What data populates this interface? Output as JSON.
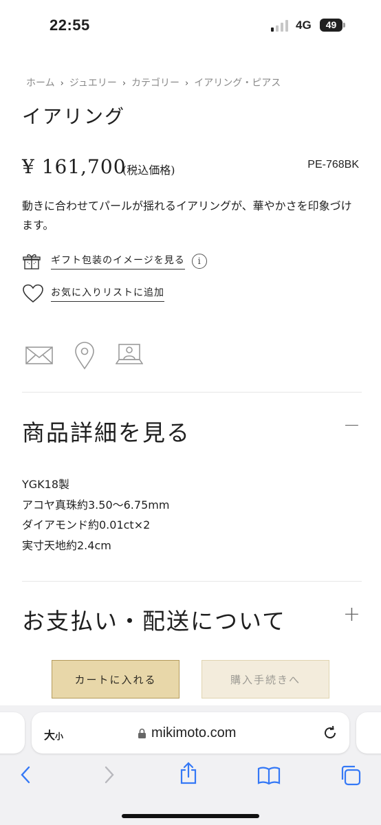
{
  "status_bar": {
    "time": "22:55",
    "network": "4G",
    "battery": "49"
  },
  "breadcrumb": [
    "ホーム",
    "ジュエリー",
    "カテゴリー",
    "イアリング・ピアス"
  ],
  "product": {
    "title": "イアリング",
    "price": "¥ 161,700",
    "tax_note": "(税込価格)",
    "code": "PE-768BK",
    "description": "動きに合わせてパールが揺れるイアリングが、華やかさを印象づけます。"
  },
  "links": {
    "gift": "ギフト包装のイメージを見る",
    "info": "i",
    "favorite": "お気に入りリストに追加"
  },
  "contact_icons": [
    "mail-icon",
    "location-pin-icon",
    "online-consultation-icon"
  ],
  "sections": {
    "details": {
      "title": "商品詳細を見る",
      "toggle": "−"
    },
    "specs": [
      "YGK18製",
      "アコヤ真珠約3.50〜6.75mm",
      "ダイアモンド約0.01ct×2",
      "実寸天地約2.4cm"
    ],
    "payment": {
      "title": "お支払い・配送について",
      "toggle": "+"
    }
  },
  "actions": {
    "add_to_cart": "カートに入れる",
    "checkout": "購入手続きへ"
  },
  "browser": {
    "text_size_large": "大",
    "text_size_small": "小",
    "url": "mikimoto.com"
  },
  "colors": {
    "cart_button": "#e8d7a9",
    "checkout_button": "#f3ecdc",
    "browser_accent": "#3478f6"
  }
}
